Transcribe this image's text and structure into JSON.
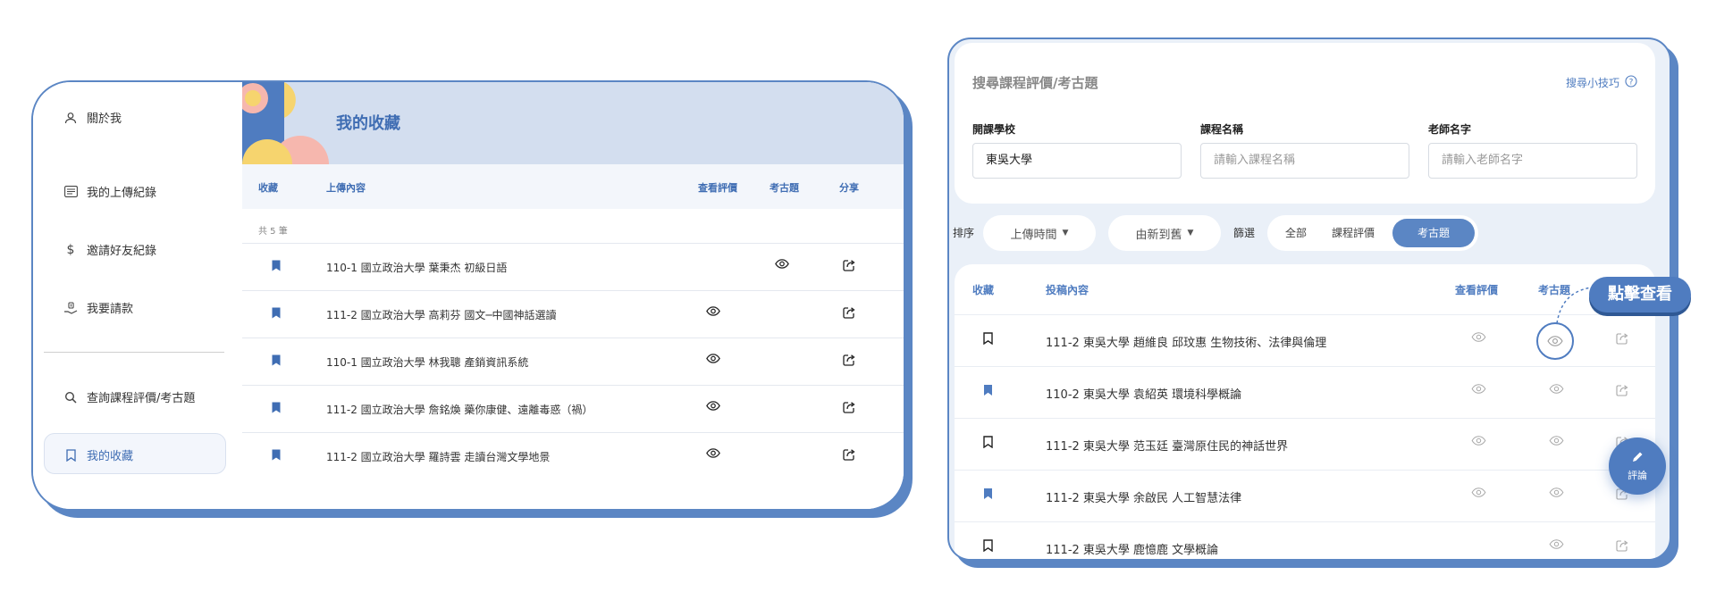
{
  "sidebar": {
    "items": [
      {
        "label": "關於我",
        "icon": "user-icon"
      },
      {
        "label": "我的上傳紀錄",
        "icon": "list-icon"
      },
      {
        "label": "邀請好友紀錄",
        "icon": "dollar-icon"
      },
      {
        "label": "我要請款",
        "icon": "hand-money-icon"
      },
      {
        "label": "查詢課程評價/考古題",
        "icon": "search-icon"
      },
      {
        "label": "我的收藏",
        "icon": "bookmark-icon",
        "active": true
      }
    ]
  },
  "favorites": {
    "title": "我的收藏",
    "columns": {
      "bookmark": "收藏",
      "content": "上傳內容",
      "review": "查看評價",
      "exam": "考古題",
      "share": "分享"
    },
    "count_text": "共 5 筆",
    "rows": [
      {
        "text": "110-1 國立政治大學 葉秉杰 初級日語",
        "review": false,
        "exam": true
      },
      {
        "text": "111-2 國立政治大學 高莉芬 國文─中國神話選讀",
        "review": true,
        "exam": false
      },
      {
        "text": "110-1 國立政治大學 林我聰 產銷資訊系統",
        "review": true,
        "exam": false
      },
      {
        "text": "111-2 國立政治大學 詹銘煥 藥你康健、遠離毒惑（禍）",
        "review": true,
        "exam": false
      },
      {
        "text": "111-2 國立政治大學 羅詩雲 走讀台灣文學地景",
        "review": true,
        "exam": false
      }
    ]
  },
  "search": {
    "title": "搜尋課程評價/考古題",
    "tip": "搜尋小技巧",
    "school_label": "開課學校",
    "school_value": "東吳大學",
    "course_label": "課程名稱",
    "course_placeholder": "請輸入課程名稱",
    "teacher_label": "老師名字",
    "teacher_placeholder": "請輸入老師名字"
  },
  "toolbar": {
    "sort_label": "排序",
    "sort_value": "上傳時間",
    "order_value": "由新到舊",
    "filter_label": "篩選",
    "filters": [
      "全部",
      "課程評價",
      "考古題"
    ],
    "active_filter": "考古題"
  },
  "results": {
    "columns": {
      "bookmark": "收藏",
      "content": "投稿內容",
      "review": "查看評價",
      "exam": "考古題"
    },
    "rows": [
      {
        "text": "111-2 東吳大學 趙維良 邱玟惠 生物技術、法律與倫理",
        "bookmarked": false,
        "review": true
      },
      {
        "text": "110-2 東吳大學 袁紹英 環境科學概論",
        "bookmarked": true,
        "review": true
      },
      {
        "text": "111-2 東吳大學 范玉廷 臺灣原住民的神話世界",
        "bookmarked": false,
        "review": true
      },
      {
        "text": "111-2 東吳大學 余啟民 人工智慧法律",
        "bookmarked": true,
        "review": true
      },
      {
        "text": "111-2 東吳大學 鹿憶鹿 文學概論",
        "bookmarked": false,
        "review": false
      }
    ]
  },
  "callout": "點擊查看",
  "fab_label": "評論",
  "colors": {
    "accent": "#4f7cc0",
    "border": "#5b86c4",
    "header_bg": "#d3deef",
    "panel_bg": "#eaf0f8"
  }
}
